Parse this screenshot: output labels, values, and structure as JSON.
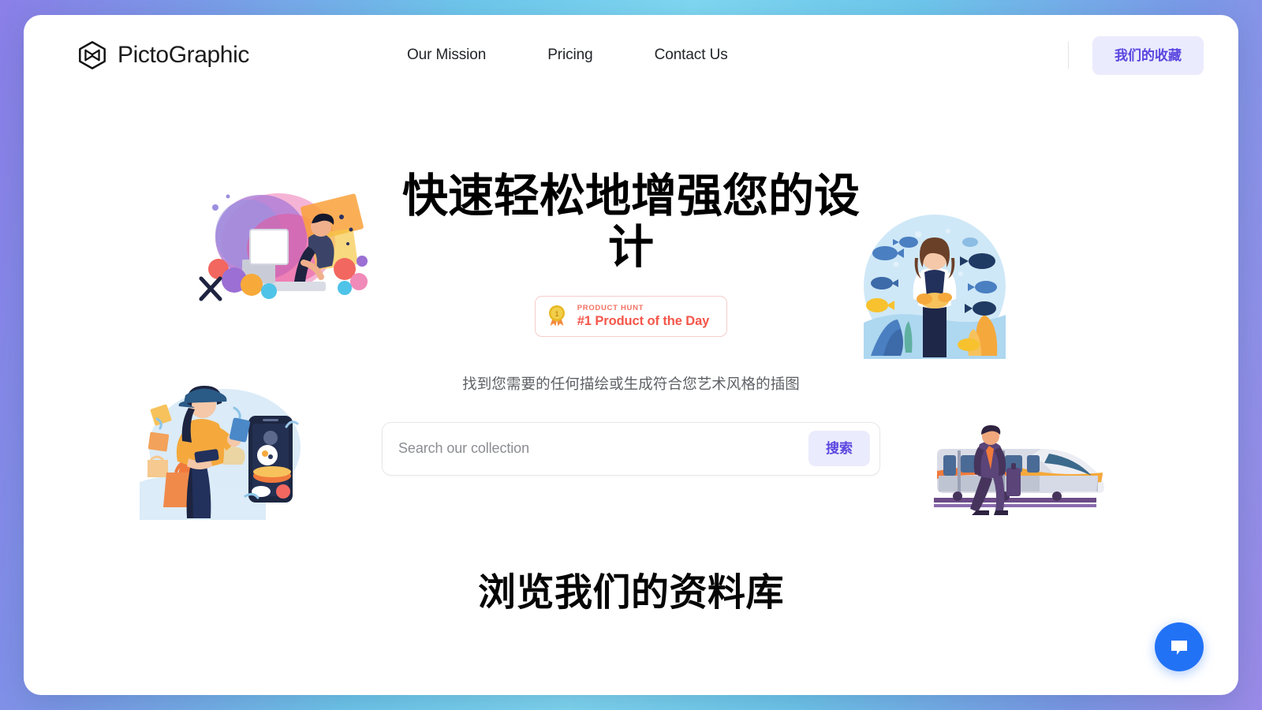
{
  "theme": {
    "page_bg": "#ffffff",
    "outer_gradient_from": "#8b7fe8",
    "outer_gradient_mid": "#7fd8f2",
    "outer_gradient_to": "#9b8ae8",
    "accent_purple": "#5b45e0",
    "accent_purple_bg": "#eaebfc",
    "badge_red": "#f4564a",
    "badge_border": "#f6cdcb",
    "chat_blue": "#2272f5",
    "text_primary": "#000000",
    "text_muted": "#5e6065"
  },
  "header": {
    "logo_icon": "hexagon-cube-icon",
    "brand_name": "PictoGraphic",
    "nav": [
      {
        "label": "Our Mission"
      },
      {
        "label": "Pricing"
      },
      {
        "label": "Contact Us"
      }
    ],
    "collection_button": "我们的收藏"
  },
  "hero": {
    "title": "快速轻松地增强您的设计",
    "badge": {
      "icon": "medal-award-icon",
      "medal_number": "1",
      "kicker": "PRODUCT HUNT",
      "headline": "#1 Product of the Day"
    },
    "subtitle": "找到您需要的任何描绘或生成符合您艺术风格的插图",
    "search": {
      "placeholder": "Search our collection",
      "value": "",
      "button_label": "搜索"
    },
    "illustrations": [
      {
        "name": "designer-at-computer-illustration"
      },
      {
        "name": "woman-with-fish-aquarium-illustration"
      },
      {
        "name": "food-delivery-woman-with-phone-illustration"
      },
      {
        "name": "businessman-walking-by-train-illustration"
      }
    ]
  },
  "browse": {
    "title": "浏览我们的资料库"
  },
  "chat_widget": {
    "icon": "chat-bubble-icon",
    "label": "Chat"
  }
}
